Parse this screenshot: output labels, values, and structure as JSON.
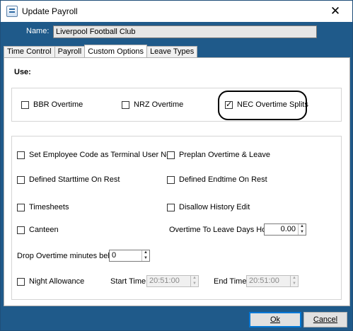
{
  "window": {
    "title": "Update Payroll",
    "close_glyph": "✕",
    "icon": "app-icon"
  },
  "name": {
    "label": "Name:",
    "value": "Liverpool Football Club"
  },
  "tabs": [
    {
      "label": "Time Control",
      "active": false
    },
    {
      "label": "Payroll",
      "active": false
    },
    {
      "label": "Custom Options",
      "active": true
    },
    {
      "label": "Leave Types",
      "active": false
    }
  ],
  "use_label": "Use:",
  "top_options": [
    {
      "label": "BBR Overtime",
      "checked": false
    },
    {
      "label": "NRZ Overtime",
      "checked": false
    },
    {
      "label": "NEC Overtime Splits",
      "checked": true
    }
  ],
  "options": {
    "set_employee_code": {
      "label": "Set Employee Code as Terminal User No.",
      "checked": false
    },
    "preplan_overtime": {
      "label": "Preplan Overtime & Leave",
      "checked": false
    },
    "defined_starttime": {
      "label": "Defined Starttime On Rest",
      "checked": false
    },
    "defined_endtime": {
      "label": "Defined Endtime On Rest",
      "checked": false
    },
    "timesheets": {
      "label": "Timesheets",
      "checked": false
    },
    "disallow_history": {
      "label": "Disallow History Edit",
      "checked": false
    },
    "canteen": {
      "label": "Canteen",
      "checked": false
    },
    "night_allowance": {
      "label": "Night Allowance",
      "checked": false
    }
  },
  "overtime_to_leave": {
    "label": "Overtime To Leave Days Hours:",
    "value": "0.00"
  },
  "drop_overtime": {
    "label": "Drop Overtime minutes below:",
    "value": "0"
  },
  "start_time": {
    "label": "Start Time:",
    "value": "20:51:00"
  },
  "end_time": {
    "label": "End Time:",
    "value": "20:51:00"
  },
  "buttons": {
    "ok": "Ok",
    "cancel": "Cancel"
  }
}
